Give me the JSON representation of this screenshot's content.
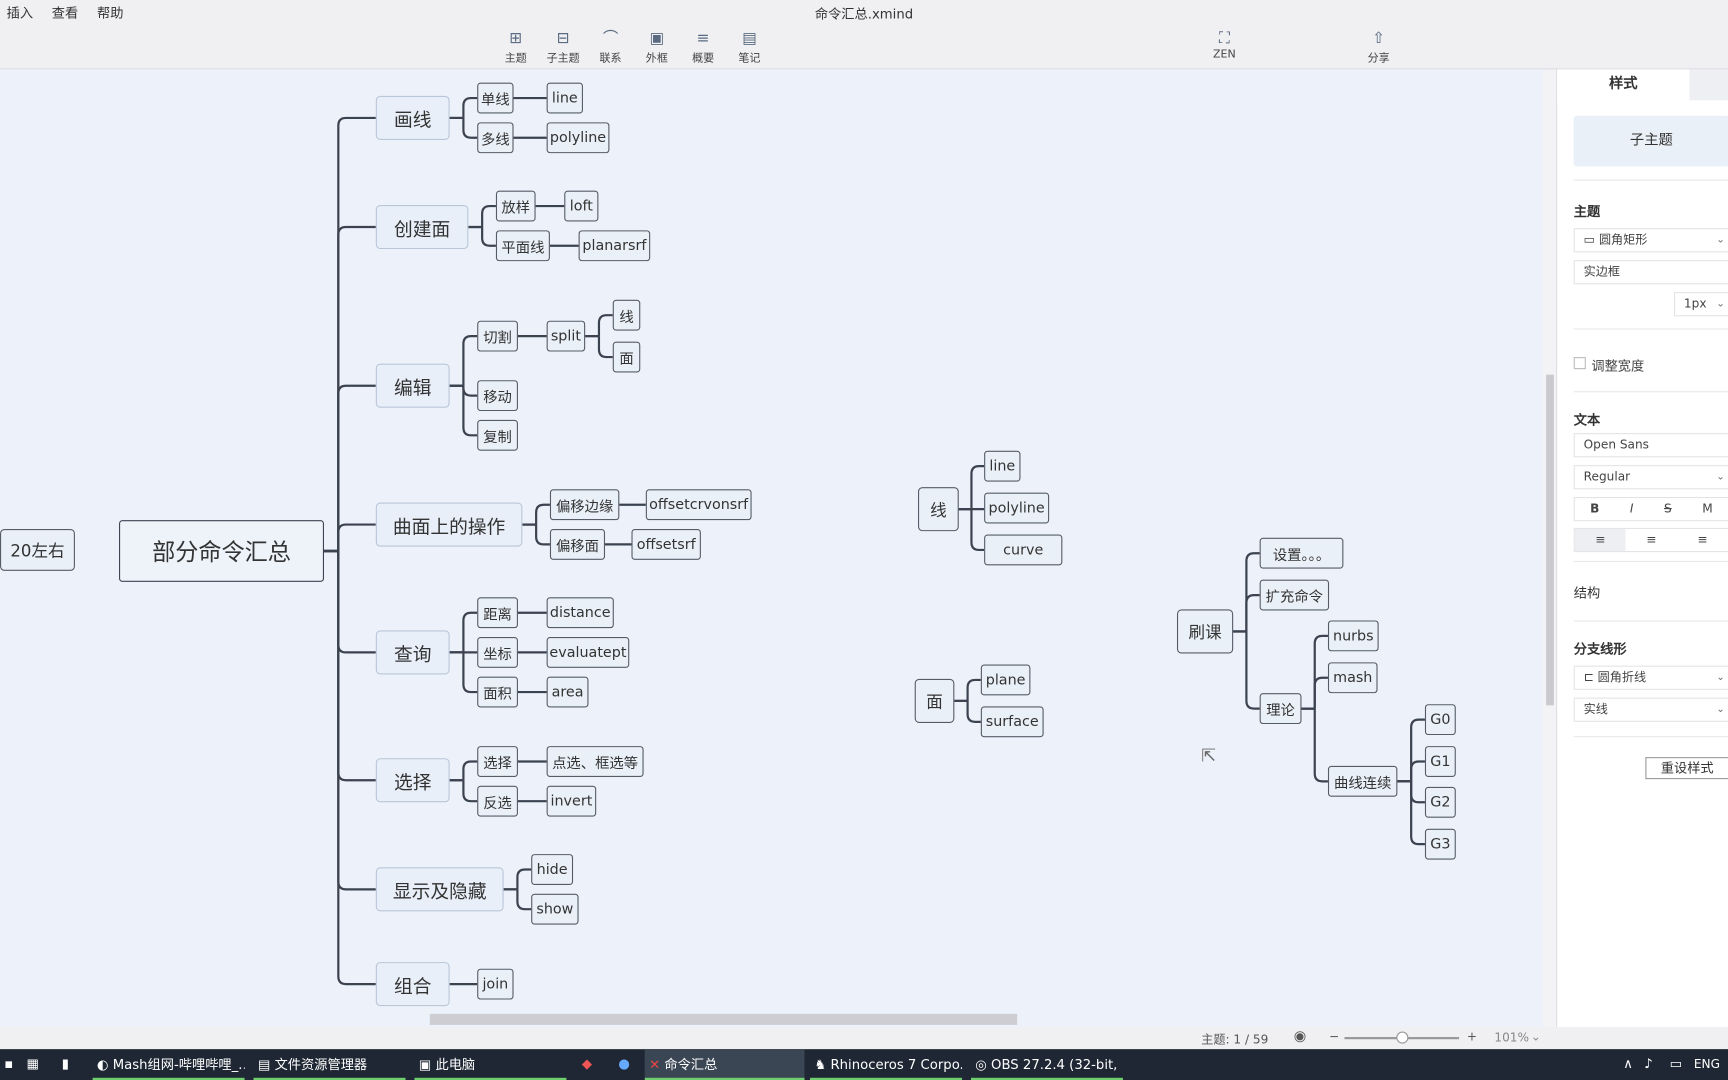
{
  "window": {
    "title": "命令汇总.xmind"
  },
  "menu": [
    "插入",
    "查看",
    "帮助"
  ],
  "toolbar": [
    {
      "label": "主题",
      "icon": "topic-icon"
    },
    {
      "label": "子主题",
      "icon": "subtopic-icon"
    },
    {
      "label": "联系",
      "icon": "relationship-icon"
    },
    {
      "label": "外框",
      "icon": "boundary-icon"
    },
    {
      "label": "概要",
      "icon": "summary-icon"
    },
    {
      "label": "笔记",
      "icon": "note-icon"
    }
  ],
  "zen": {
    "label": "ZEN",
    "icon": "fullscreen-icon"
  },
  "share": {
    "label": "分享",
    "icon": "share-icon"
  },
  "mindmap": {
    "central": "部分命令汇总",
    "floating_label": "20左右",
    "branches": [
      {
        "label": "画线",
        "children": [
          {
            "label": "单线",
            "children": [
              {
                "label": "line"
              }
            ]
          },
          {
            "label": "多线",
            "children": [
              {
                "label": "polyline"
              }
            ]
          }
        ]
      },
      {
        "label": "创建面",
        "children": [
          {
            "label": "放样",
            "children": [
              {
                "label": "loft"
              }
            ]
          },
          {
            "label": "平面线",
            "children": [
              {
                "label": "planarsrf"
              }
            ]
          }
        ]
      },
      {
        "label": "编辑",
        "children": [
          {
            "label": "切割",
            "children": [
              {
                "label": "split",
                "children": [
                  {
                    "label": "线"
                  },
                  {
                    "label": "面"
                  }
                ]
              }
            ]
          },
          {
            "label": "移动"
          },
          {
            "label": "复制"
          }
        ]
      },
      {
        "label": "曲面上的操作",
        "children": [
          {
            "label": "偏移边缘",
            "children": [
              {
                "label": "offsetcrvonsrf"
              }
            ]
          },
          {
            "label": "偏移面",
            "children": [
              {
                "label": "offsetsrf"
              }
            ]
          }
        ]
      },
      {
        "label": "查询",
        "children": [
          {
            "label": "距离",
            "children": [
              {
                "label": "distance"
              }
            ]
          },
          {
            "label": "坐标",
            "children": [
              {
                "label": "evaluatept"
              }
            ]
          },
          {
            "label": "面积",
            "children": [
              {
                "label": "area"
              }
            ]
          }
        ]
      },
      {
        "label": "选择",
        "children": [
          {
            "label": "选择",
            "children": [
              {
                "label": "点选、框选等"
              }
            ]
          },
          {
            "label": "反选",
            "children": [
              {
                "label": "invert"
              }
            ]
          }
        ]
      },
      {
        "label": "显示及隐藏",
        "children": [
          {
            "label": "hide"
          },
          {
            "label": "show"
          }
        ]
      },
      {
        "label": "组合",
        "children": [
          {
            "label": "join"
          }
        ]
      }
    ],
    "floating_topics": [
      {
        "label": "线",
        "children": [
          {
            "label": "line"
          },
          {
            "label": "polyline"
          },
          {
            "label": "curve"
          }
        ]
      },
      {
        "label": "面",
        "children": [
          {
            "label": "plane"
          },
          {
            "label": "surface"
          }
        ]
      },
      {
        "label": "刷课",
        "children": [
          {
            "label": "设置。。。"
          },
          {
            "label": "扩充命令"
          },
          {
            "label": "理论",
            "children": [
              {
                "label": "nurbs"
              },
              {
                "label": "mash"
              },
              {
                "label": "曲线连续",
                "children": [
                  {
                    "label": "G0"
                  },
                  {
                    "label": "G1"
                  },
                  {
                    "label": "G2"
                  },
                  {
                    "label": "G3"
                  }
                ]
              }
            ]
          }
        ]
      }
    ],
    "line_color": "#3c4350",
    "canvas_color": "#edf2fa"
  },
  "panel": {
    "tabs": [
      "样式"
    ],
    "preview": "子主题",
    "topic_section": "主题",
    "shape": "圆角矩形",
    "border": "实边框",
    "border_width": "1px",
    "adjust_width": "调整宽度",
    "adjust_width_checked": false,
    "text_section": "文本",
    "font": "Open Sans",
    "weight": "Regular",
    "bold": "B",
    "italic": "I",
    "strike": "S",
    "more": "M",
    "structure": "结构",
    "branch_section": "分支线形",
    "branch_shape": "圆角折线",
    "line_style": "实线",
    "reset": "重设样式"
  },
  "status": {
    "topics": "主题: 1 / 59",
    "zoom": "101%",
    "zoom_slider_percent": 50
  },
  "taskbar": {
    "apps": [
      "Mash组网-哔哩哔哩_...",
      "文件资源管理器",
      "此电脑",
      "命令汇总",
      "Rhinoceros 7 Corpo...",
      "OBS 27.2.4 (32-bit, ..."
    ],
    "lang": "ENG"
  }
}
